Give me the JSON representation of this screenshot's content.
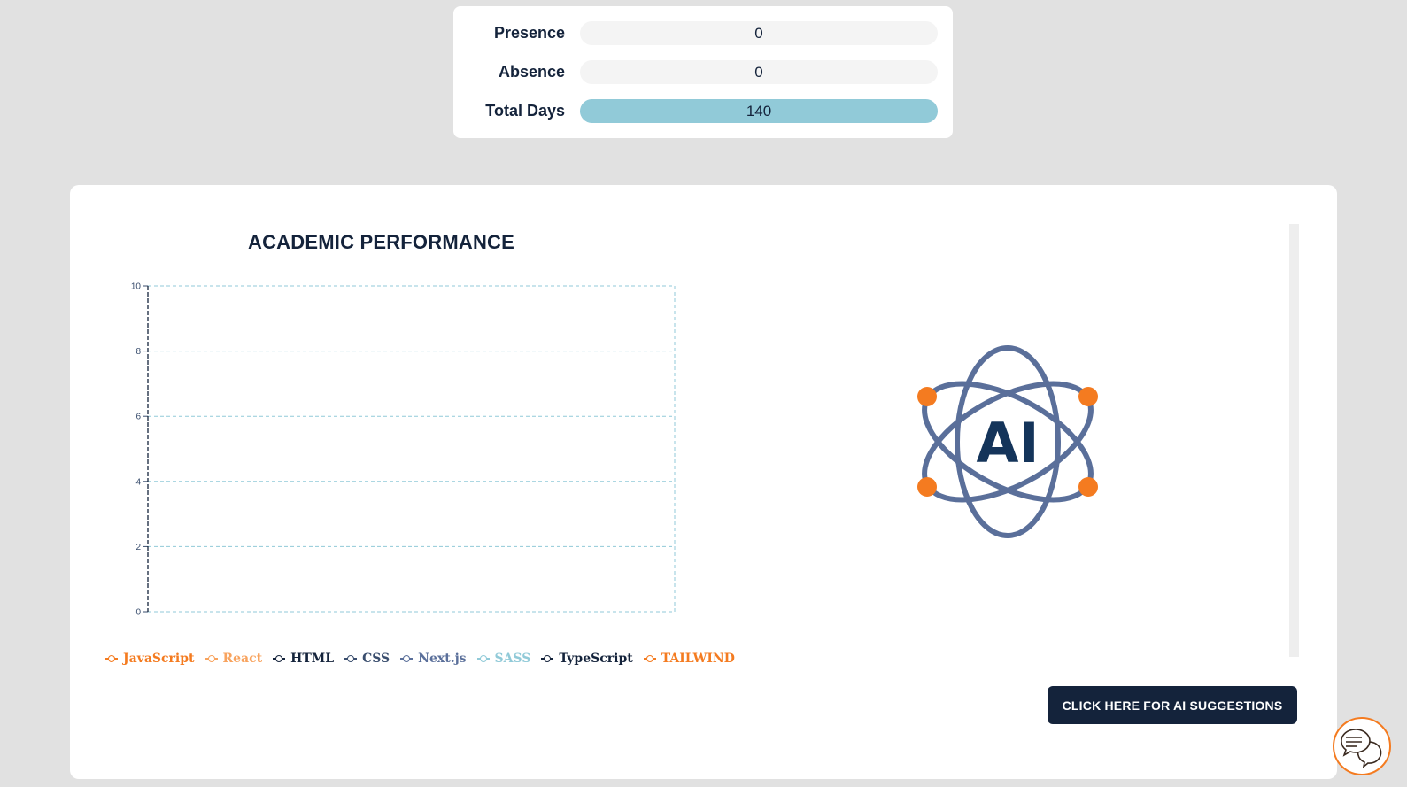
{
  "attendance": {
    "rows": [
      {
        "label": "Presence",
        "value": "0"
      },
      {
        "label": "Absence",
        "value": "0"
      },
      {
        "label": "Total Days",
        "value": "140"
      }
    ]
  },
  "performance": {
    "title": "ACADEMIC PERFORMANCE",
    "legend": [
      {
        "name": "JavaScript",
        "color": "#f47b20"
      },
      {
        "name": "React",
        "color": "#f8a35e"
      },
      {
        "name": "HTML",
        "color": "#14233b"
      },
      {
        "name": "CSS",
        "color": "#3a4e6e"
      },
      {
        "name": "Next.js",
        "color": "#5a6f9a"
      },
      {
        "name": "SASS",
        "color": "#91cad8"
      },
      {
        "name": "TypeScript",
        "color": "#14233b"
      },
      {
        "name": "TAILWIND",
        "color": "#f47b20"
      }
    ]
  },
  "chart_data": {
    "type": "line",
    "title": "ACADEMIC PERFORMANCE",
    "xlabel": "",
    "ylabel": "",
    "ylim": [
      0,
      10
    ],
    "y_ticks": [
      0,
      2,
      4,
      6,
      8,
      10
    ],
    "categories": [],
    "series": [
      {
        "name": "JavaScript",
        "values": []
      },
      {
        "name": "React",
        "values": []
      },
      {
        "name": "HTML",
        "values": []
      },
      {
        "name": "CSS",
        "values": []
      },
      {
        "name": "Next.js",
        "values": []
      },
      {
        "name": "SASS",
        "values": []
      },
      {
        "name": "TypeScript",
        "values": []
      },
      {
        "name": "TAILWIND",
        "values": []
      }
    ],
    "grid": true,
    "legend_position": "bottom"
  },
  "ai": {
    "logo_text": "AI",
    "button_label": "CLICK HERE FOR AI SUGGESTIONS"
  },
  "colors": {
    "navy": "#14233b",
    "orange": "#f47b20",
    "teal": "#91cad8",
    "slate": "#5a6f9a"
  },
  "icons": {
    "chat": "chat-bubbles-icon",
    "ai": "atom-ai-icon"
  }
}
